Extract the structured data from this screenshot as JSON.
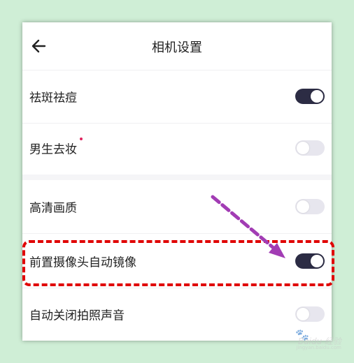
{
  "header": {
    "title": "相机设置"
  },
  "settings": [
    {
      "label": "祛斑祛痘",
      "enabled": true
    },
    {
      "label": "男生去妆",
      "enabled": false,
      "new_dot": true
    },
    {
      "label": "高清画质",
      "enabled": false
    },
    {
      "label": "前置摄像头自动镜像",
      "enabled": true,
      "highlighted": true
    },
    {
      "label": "自动关闭拍照声音",
      "enabled": false
    }
  ],
  "colors": {
    "background": "#cfeed6",
    "toggle_on": "#2c2c44",
    "toggle_off": "#e7e6ee",
    "highlight": "#e00000",
    "arrow": "#a23cb4",
    "new_dot": "#e0245e"
  },
  "icons": {
    "back": "arrow-left-icon",
    "watermark": "baidu-paw-icon"
  },
  "watermark": {
    "text": "Baidu 经验",
    "subtext": "jingyan.baidu.com"
  }
}
